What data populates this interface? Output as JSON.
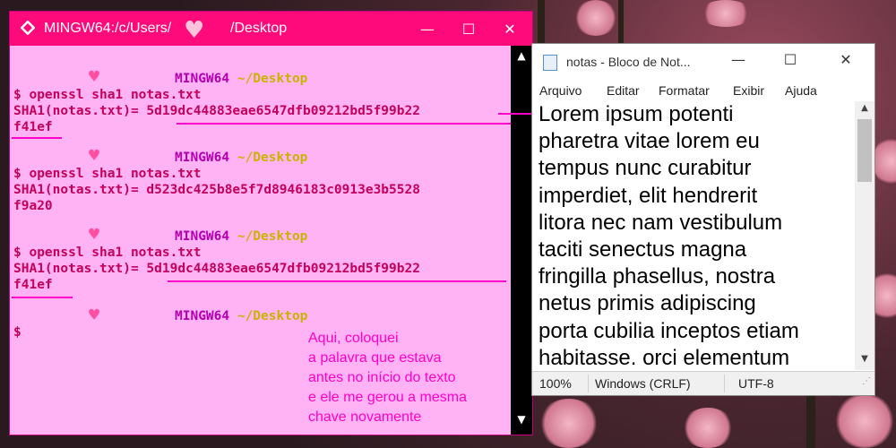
{
  "terminal": {
    "title_left": "MINGW64:/c/Users/",
    "title_right": "/Desktop",
    "heart_glyph": "♥",
    "prompt_user": "MINGW64",
    "prompt_path": "~/Desktop",
    "blocks": [
      {
        "cmd": "$ openssl sha1 notas.txt",
        "hash1": "SHA1(notas.txt)= 5d19dc44883eae6547dfb09212bd5f99b22",
        "hash2": "f41ef"
      },
      {
        "cmd": "$ openssl sha1 notas.txt",
        "hash1": "SHA1(notas.txt)= d523dc425b8e5f7d8946183c0913e3b5528",
        "hash2": "f9a20"
      },
      {
        "cmd": "$ openssl sha1 notas.txt",
        "hash1": "SHA1(notas.txt)= 5d19dc44883eae6547dfb09212bd5f99b22",
        "hash2": "f41ef"
      }
    ],
    "last_prompt": "$",
    "annotation": "Aqui, coloquei\na palavra que estava\nantes no início do texto\ne ele me gerou a mesma\nchave novamente"
  },
  "notepad": {
    "title": "notas - Bloco de Not...",
    "menu": [
      "Arquivo",
      "Editar",
      "Formatar",
      "Exibir",
      "Ajuda"
    ],
    "text": "Lorem ipsum potenti\npharetra vitae lorem eu\ntempus nunc curabitur\nimperdiet, elit hendrerit\nlitora nec nam vestibulum\ntaciti senectus magna\nfringilla phasellus, nostra\nnetus primis adipiscing\nporta cubilia inceptos etiam\nhabitasse. orci elementum",
    "status": {
      "zoom": "100%",
      "eol": "Windows (CRLF)",
      "encoding": "UTF-8"
    }
  },
  "colors": {
    "terminal_bg": "#ffb3f5",
    "titlebar": "#ff0a7a",
    "accent": "#ff00c8"
  }
}
